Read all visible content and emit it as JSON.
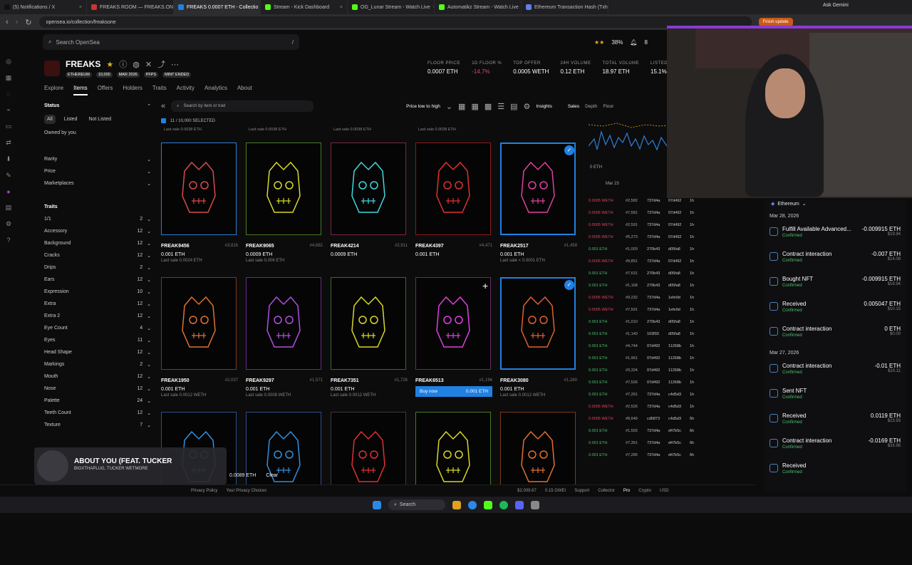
{
  "browser": {
    "tabs": [
      {
        "label": "(5) Notifications / X",
        "active": false,
        "color": "#111"
      },
      {
        "label": "FREAKS ROOM — FREAKS.ONE",
        "active": false,
        "color": "#c33"
      },
      {
        "label": "FREAKS 0.0007 ETH - Collectio",
        "active": true,
        "color": "#2081e2"
      },
      {
        "label": "Stream - Kick Dashboard",
        "active": false,
        "color": "#53fc18"
      },
      {
        "label": "OG_Lunar Stream - Watch Live",
        "active": false,
        "color": "#53fc18"
      },
      {
        "label": "Automatikz Stream - Watch Live",
        "active": false,
        "color": "#53fc18"
      },
      {
        "label": "Ethereum Transaction Hash (Txh",
        "active": false,
        "color": "#627eea"
      }
    ],
    "url": "opensea.io/collection/freaksone",
    "ask": "Ask Gemini",
    "finish": "Finish update"
  },
  "header": {
    "search_placeholder": "Search OpenSea",
    "slash": "/",
    "rating": "38%",
    "notif": "8"
  },
  "collection": {
    "name": "FREAKS",
    "chain": "ETHEREUM",
    "supply": "10,000",
    "date": "MAR 2026",
    "type": "PFPS",
    "status": "MINT ENDED"
  },
  "stats": [
    {
      "label": "FLOOR PRICE",
      "value": "0.0007 ETH"
    },
    {
      "label": "1D FLOOR %",
      "value": "-14.7%"
    },
    {
      "label": "TOP OFFER",
      "value": "0.0005 WETH"
    },
    {
      "label": "24H VOLUME",
      "value": "0.12 ETH"
    },
    {
      "label": "TOTAL VOLUME",
      "value": "18.97 ETH"
    },
    {
      "label": "LISTED",
      "value": "15.1%"
    }
  ],
  "subnav": [
    "Explore",
    "Items",
    "Offers",
    "Holders",
    "Traits",
    "Activity",
    "Analytics",
    "About"
  ],
  "toolbar": {
    "search_placeholder": "Search by item or trait",
    "sort": "Price low to high",
    "insights": "Insights",
    "sales": "Sales",
    "depth": "Depth",
    "floor": "Floor",
    "selected": "11 / 10,000 SELECTED"
  },
  "sidebar": {
    "status": "Status",
    "filters": [
      "All",
      "Listed",
      "Not Listed"
    ],
    "owned": "Owned by you",
    "sections": [
      "Rarity",
      "Price",
      "Marketplaces"
    ],
    "traits_title": "Traits",
    "traits": [
      {
        "n": "1/1",
        "c": "2"
      },
      {
        "n": "Accessory",
        "c": "12"
      },
      {
        "n": "Background",
        "c": "12"
      },
      {
        "n": "Cracks",
        "c": "12"
      },
      {
        "n": "Drips",
        "c": "2"
      },
      {
        "n": "Ears",
        "c": "12"
      },
      {
        "n": "Expression",
        "c": "10"
      },
      {
        "n": "Extra",
        "c": "12"
      },
      {
        "n": "Extra 2",
        "c": "12"
      },
      {
        "n": "Eye Count",
        "c": "4"
      },
      {
        "n": "Eyes",
        "c": "11"
      },
      {
        "n": "Head Shape",
        "c": "12"
      },
      {
        "n": "Markings",
        "c": "2"
      },
      {
        "n": "Mouth",
        "c": "12"
      },
      {
        "n": "Nose",
        "c": "12"
      },
      {
        "n": "Palette",
        "c": "24"
      },
      {
        "n": "Teeth Count",
        "c": "12"
      },
      {
        "n": "Texture",
        "c": "7"
      }
    ]
  },
  "top_lastsales": [
    "Last sale 0.0038 ETH",
    "Last sale 0.0038 ETH",
    "Last sale 0.0038 ETH",
    "Last sale 0.0038 ETH"
  ],
  "nfts": [
    {
      "name": "FREAK9456",
      "rank": "#3,816",
      "price": "0.001 ETH",
      "last": "Last sale 0.0024 ETH",
      "color": "#2f7fd6",
      "hue": "#d84a4a",
      "sel": false
    },
    {
      "name": "FREAK9065",
      "rank": "#4,682",
      "price": "0.0009 ETH",
      "last": "Last sale 0.006 ETH",
      "color": "#4a7a25",
      "hue": "#d8d82a",
      "sel": false
    },
    {
      "name": "FREAK4214",
      "rank": "#2,911",
      "price": "0.0009 ETH",
      "last": "",
      "color": "#7a2545",
      "hue": "#40d8e0",
      "sel": false
    },
    {
      "name": "FREAK4397",
      "rank": "#4,471",
      "price": "0.001 ETH",
      "last": "",
      "color": "#8a1a1a",
      "hue": "#e03030",
      "sel": false
    },
    {
      "name": "FREAK2517",
      "rank": "#1,459",
      "price": "0.001 ETH",
      "last": "Last sale < 0.0001 ETH",
      "color": "#2081e2",
      "hue": "#e040a0",
      "sel": true
    },
    {
      "name": "FREAK1950",
      "rank": "#2,037",
      "price": "0.001 ETH",
      "last": "Last sale 0.0012 WETH",
      "color": "#7a3a18",
      "hue": "#e07030",
      "sel": false
    },
    {
      "name": "FREAK9297",
      "rank": "#1,571",
      "price": "0.001 ETH",
      "last": "Last sale 0.0008 WETH",
      "color": "#6a2a8a",
      "hue": "#b050e0",
      "sel": false
    },
    {
      "name": "FREAK7351",
      "rank": "#1,726",
      "price": "0.001 ETH",
      "last": "Last sale 0.0012 WETH",
      "color": "#3a6a25",
      "hue": "#d8d82a",
      "sel": false
    },
    {
      "name": "FREAK6513",
      "rank": "#1,194",
      "price": "0.001 ETH",
      "last": "",
      "color": "#6a2a6a",
      "hue": "#e040e0",
      "sel": false,
      "buy": "Buy now"
    },
    {
      "name": "FREAK3080",
      "rank": "#1,260",
      "price": "0.001 ETH",
      "last": "Last sale 0.0012 WETH",
      "color": "#2081e2",
      "hue": "#e06030",
      "sel": true
    },
    {
      "name": "",
      "rank": "",
      "price": "",
      "last": "",
      "color": "#2f4f8a",
      "hue": "#3090e0",
      "sel": false
    },
    {
      "name": "",
      "rank": "",
      "price": "",
      "last": "",
      "color": "#2f4f8a",
      "hue": "#3090e0",
      "sel": false
    },
    {
      "name": "",
      "rank": "",
      "price": "",
      "last": "",
      "color": "#3a3a3a",
      "hue": "#e03030",
      "sel": false
    },
    {
      "name": "",
      "rank": "",
      "price": "",
      "last": "",
      "color": "#4a7a25",
      "hue": "#d8d82a",
      "sel": false
    },
    {
      "name": "",
      "rank": "",
      "price": "",
      "last": "",
      "color": "#7a3a18",
      "hue": "#e07030",
      "sel": false
    }
  ],
  "chart": {
    "eth": "0 ETH",
    "date": "Mar 23"
  },
  "sales_rows": [
    {
      "p": "0.0005 WETH",
      "id": "#2,582",
      "f": "737d4a",
      "t": "07d492",
      "a": "1h",
      "c": "e"
    },
    {
      "p": "0.0005 WETH",
      "id": "#7,581",
      "f": "737d4a",
      "t": "07d492",
      "a": "1h",
      "c": "e"
    },
    {
      "p": "0.0005 WETH",
      "id": "#2,591",
      "f": "737d4a",
      "t": "07d492",
      "a": "1h",
      "c": "e"
    },
    {
      "p": "0.0005 WETH",
      "id": "#5,273",
      "f": "737d4a",
      "t": "07d492",
      "a": "1h",
      "c": "e"
    },
    {
      "p": "0.001 ETH",
      "id": "#1,003",
      "f": "270b43",
      "t": "d05fa8",
      "a": "1h",
      "c": "g"
    },
    {
      "p": "0.0005 WETH",
      "id": "#9,851",
      "f": "737d4a",
      "t": "07d492",
      "a": "1h",
      "c": "e"
    },
    {
      "p": "0.001 ETH",
      "id": "#7,631",
      "f": "270b43",
      "t": "d05fa8",
      "a": "1h",
      "c": "g"
    },
    {
      "p": "0.001 ETH",
      "id": "#1,168",
      "f": "270b43",
      "t": "d05fa8",
      "a": "1h",
      "c": "g"
    },
    {
      "p": "0.0005 WETH",
      "id": "#9,232",
      "f": "737d4a",
      "t": "1efe9d",
      "a": "1h",
      "c": "e"
    },
    {
      "p": "0.0005 WETH",
      "id": "#7,591",
      "f": "737d4a",
      "t": "1efe9d",
      "a": "1h",
      "c": "e"
    },
    {
      "p": "0.001 ETH",
      "id": "#1,010",
      "f": "270b43",
      "t": "d05fa8",
      "a": "1h",
      "c": "g"
    },
    {
      "p": "0.001 ETH",
      "id": "#1,140",
      "f": "103f93",
      "t": "d05fa8",
      "a": "1h",
      "c": "g"
    },
    {
      "p": "0.001 ETH",
      "id": "#4,744",
      "f": "07d492",
      "t": "11268b",
      "a": "1h",
      "c": "g"
    },
    {
      "p": "0.001 ETH",
      "id": "#1,961",
      "f": "07d492",
      "t": "11268b",
      "a": "1h",
      "c": "g"
    },
    {
      "p": "0.001 ETH",
      "id": "#3,324",
      "f": "07d492",
      "t": "11268b",
      "a": "1h",
      "c": "g"
    },
    {
      "p": "0.001 ETH",
      "id": "#7,526",
      "f": "07d492",
      "t": "11268b",
      "a": "1h",
      "c": "g"
    },
    {
      "p": "0.001 ETH",
      "id": "#7,261",
      "f": "737d4a",
      "t": "c4d5d3",
      "a": "1h",
      "c": "g"
    },
    {
      "p": "0.0005 WETH",
      "id": "#2,526",
      "f": "737d4a",
      "t": "c4d5d3",
      "a": "1h",
      "c": "e"
    },
    {
      "p": "0.0005 WETH",
      "id": "#8,649",
      "f": "cd5873",
      "t": "c4d5d3",
      "a": "5h",
      "c": "e"
    },
    {
      "p": "0.001 ETH",
      "id": "#1,593",
      "f": "737d4a",
      "t": "d47b5c",
      "a": "6h",
      "c": "g"
    },
    {
      "p": "0.001 ETH",
      "id": "#7,351",
      "f": "737d4a",
      "t": "d47b5c",
      "a": "6h",
      "c": "g"
    },
    {
      "p": "0.001 ETH",
      "id": "#7,285",
      "f": "737d4a",
      "t": "d47b5c",
      "a": "6h",
      "c": "g"
    }
  ],
  "wallet": {
    "network": "Ethereum",
    "groups": [
      {
        "date": "Mar 28, 2026",
        "items": [
          {
            "t": "Fulfill Available Advanced...",
            "s": "Confirmed",
            "a": "-0.009915 ETH",
            "u": "$19.94"
          },
          {
            "t": "Contract interaction",
            "s": "Confirmed",
            "a": "-0.007 ETH",
            "u": "$14.08"
          },
          {
            "t": "Bought NFT",
            "s": "Confirmed",
            "a": "-0.009915 ETH",
            "u": "$19.94"
          },
          {
            "t": "Received",
            "s": "Confirmed",
            "a": "0.005047 ETH",
            "u": "$10.15"
          },
          {
            "t": "Contract interaction",
            "s": "Confirmed",
            "a": "0 ETH",
            "u": "$0.00"
          }
        ]
      },
      {
        "date": "Mar 27, 2026",
        "items": [
          {
            "t": "Contract interaction",
            "s": "Confirmed",
            "a": "-0.01 ETH",
            "u": "$20.11"
          },
          {
            "t": "Sent NFT",
            "s": "Confirmed",
            "a": "",
            "u": ""
          },
          {
            "t": "Received",
            "s": "Confirmed",
            "a": "0.0119 ETH",
            "u": "$23.93"
          },
          {
            "t": "Contract interaction",
            "s": "Confirmed",
            "a": "-0.0169 ETH",
            "u": "$33.98"
          },
          {
            "t": "Received",
            "s": "Confirmed",
            "a": "",
            "u": ""
          }
        ]
      }
    ]
  },
  "music": {
    "title": "ABOUT YOU (FEAT. TUCKER",
    "artist": "BIGXTHAPLUG, TUCKER WETMORE"
  },
  "cart": {
    "value": "0.0089 ETH",
    "clear": "Clear"
  },
  "footer": {
    "links": [
      "Privacy Policy",
      "Your Privacy Choices"
    ],
    "eth": "$2,009.67",
    "gas": "0.15 GWEI",
    "support": "Support",
    "collector": "Collector",
    "pro": "Pro",
    "crypto": "Crypto",
    "usd": "USD"
  },
  "taskbar": {
    "search": "Search"
  },
  "cursor": "+"
}
